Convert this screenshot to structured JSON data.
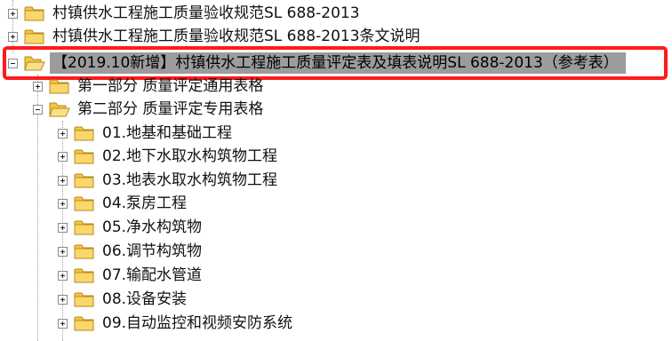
{
  "highlight_color": "#ff1a1a",
  "folder_color": "#f4c542",
  "tree": {
    "items": [
      {
        "label": "村镇供水工程施工质量验收规范SL 688-2013",
        "toggle": "plus",
        "folder": "closed",
        "icon": "folder-icon"
      },
      {
        "label": "村镇供水工程施工质量验收规范SL 688-2013条文说明",
        "toggle": "plus",
        "folder": "closed",
        "icon": "folder-icon"
      },
      {
        "label": "【2019.10新增】村镇供水工程施工质量评定表及填表说明SL 688-2013（参考表）",
        "toggle": "minus",
        "folder": "open",
        "icon": "folder-open-icon",
        "selected": true
      },
      {
        "label": "第一部分 质量评定通用表格",
        "toggle": "plus",
        "folder": "closed",
        "icon": "folder-icon"
      },
      {
        "label": "第二部分 质量评定专用表格",
        "toggle": "minus",
        "folder": "open",
        "icon": "folder-open-icon"
      },
      {
        "label": "01.地基和基础工程",
        "toggle": "plus",
        "folder": "closed",
        "icon": "folder-icon"
      },
      {
        "label": "02.地下水取水构筑物工程",
        "toggle": "plus",
        "folder": "closed",
        "icon": "folder-icon"
      },
      {
        "label": "03.地表水取水构筑物工程",
        "toggle": "plus",
        "folder": "closed",
        "icon": "folder-icon"
      },
      {
        "label": "04.泵房工程",
        "toggle": "plus",
        "folder": "closed",
        "icon": "folder-icon"
      },
      {
        "label": "05.净水构筑物",
        "toggle": "plus",
        "folder": "closed",
        "icon": "folder-icon"
      },
      {
        "label": "06.调节构筑物",
        "toggle": "plus",
        "folder": "closed",
        "icon": "folder-icon"
      },
      {
        "label": "07.输配水管道",
        "toggle": "plus",
        "folder": "closed",
        "icon": "folder-icon"
      },
      {
        "label": "08.设备安装",
        "toggle": "plus",
        "folder": "closed",
        "icon": "folder-icon"
      },
      {
        "label": "09.自动监控和视频安防系统",
        "toggle": "plus",
        "folder": "closed",
        "icon": "folder-icon"
      }
    ]
  }
}
